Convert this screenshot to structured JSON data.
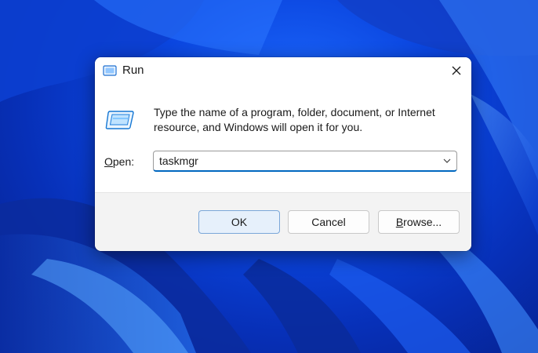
{
  "dialog": {
    "title": "Run",
    "instructions": "Type the name of a program, folder, document, or Internet resource, and Windows will open it for you.",
    "open_label_prefix": "O",
    "open_label_rest": "pen:",
    "open_value": "taskmgr",
    "buttons": {
      "ok": "OK",
      "cancel": "Cancel",
      "browse_prefix": "B",
      "browse_rest": "rowse..."
    }
  },
  "icons": {
    "title": "run-icon",
    "big": "run-icon",
    "close": "close-icon",
    "dropdown": "chevron-down-icon"
  },
  "colors": {
    "wallpaper": "#0b46e0",
    "focus_accent": "#0067c0",
    "ok_button_bg": "#e6f0fb"
  }
}
